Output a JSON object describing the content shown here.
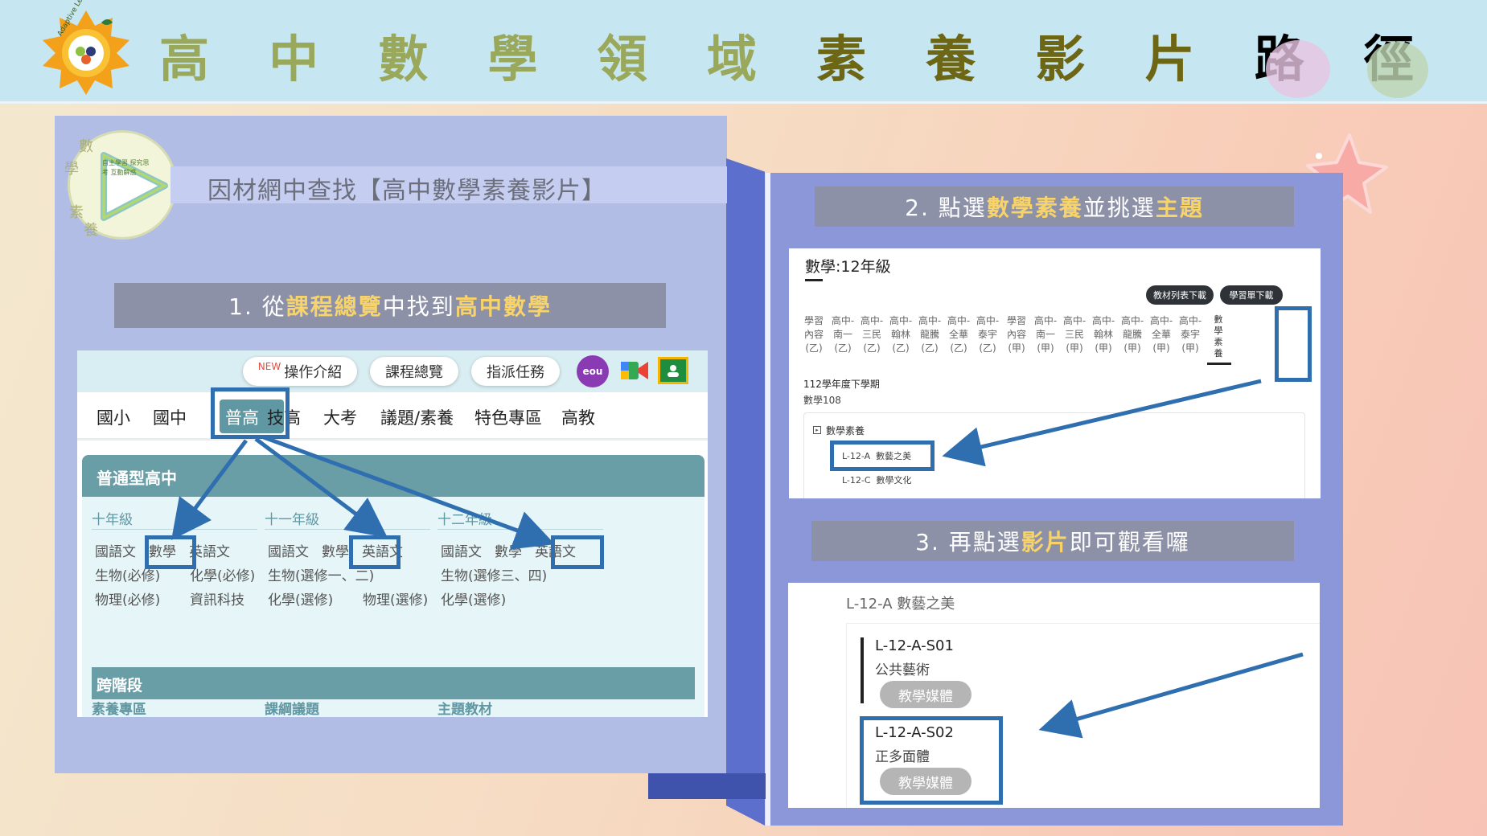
{
  "header": {
    "title_chars": [
      "高",
      "中",
      "數",
      "學",
      "領",
      "域",
      "素",
      "養",
      "影",
      "片",
      "路",
      "徑"
    ],
    "title_colors": [
      "#9aa85b",
      "#9aa85b",
      "#9aa85b",
      "#9aa85b",
      "#9aa85b",
      "#9aa85b",
      "#6d6614",
      "#6d6614",
      "#6d6614",
      "#6d6614",
      "#000000",
      "#000000"
    ],
    "logo_text": "Adaptive Learning"
  },
  "left": {
    "title": "因材網中查找【高中數學素養影片】",
    "emblem_chars": [
      "數",
      "學",
      "素",
      "養"
    ],
    "emblem_inner": "自主學習 探究思考 互動解惑",
    "step1": {
      "prefix": "1. 從",
      "hl1": "課程總覽",
      "middle": "中找到",
      "hl2": "高中數學"
    },
    "shot1": {
      "new_badge": "NEW",
      "buttons": [
        "操作介紹",
        "課程總覽",
        "指派任務"
      ],
      "app_badge": "eou",
      "nav": [
        "國小",
        "國中",
        "普高",
        "技高",
        "大考",
        "議題/素養",
        "特色專區",
        "高教"
      ],
      "section": "普通型高中",
      "grades": [
        {
          "title": "十年級",
          "rows": [
            [
              "國語文",
              "數學",
              "英語文"
            ],
            [
              "生物(必修)",
              "化學(必修)"
            ],
            [
              "物理(必修)",
              "資訊科技"
            ]
          ]
        },
        {
          "title": "十一年級",
          "rows": [
            [
              "國語文",
              "數學",
              "英語文"
            ],
            [
              "生物(選修一、二)"
            ],
            [
              "化學(選修)",
              "物理(選修)"
            ]
          ]
        },
        {
          "title": "十二年級",
          "rows": [
            [
              "國語文",
              "數學",
              "英語文"
            ],
            [
              "生物(選修三、四)"
            ],
            [
              "化學(選修)"
            ]
          ]
        }
      ],
      "cross_section": "跨階段",
      "cross_items": [
        "素養專區",
        "課綱議題",
        "主題教材"
      ]
    }
  },
  "right": {
    "step2": {
      "prefix": "2. 點選",
      "hl1": "數學素養",
      "middle": "並挑選",
      "hl2": "主題"
    },
    "step3": {
      "prefix": "3. 再點選",
      "hl1": "影片",
      "suffix": "即可觀看囉"
    },
    "shot2": {
      "heading": "數學:12年級",
      "pills": [
        "教材列表下載",
        "學習單下載"
      ],
      "tabs": [
        [
          "學習",
          "內容",
          "(乙)"
        ],
        [
          "高中-",
          "南一",
          "(乙)"
        ],
        [
          "高中-",
          "三民",
          "(乙)"
        ],
        [
          "高中-",
          "翰林",
          "(乙)"
        ],
        [
          "高中-",
          "龍騰",
          "(乙)"
        ],
        [
          "高中-",
          "全華",
          "(乙)"
        ],
        [
          "高中-",
          "泰宇",
          "(乙)"
        ],
        [
          "學習",
          "內容",
          "(甲)"
        ],
        [
          "高中-",
          "南一",
          "(甲)"
        ],
        [
          "高中-",
          "三民",
          "(甲)"
        ],
        [
          "高中-",
          "翰林",
          "(甲)"
        ],
        [
          "高中-",
          "龍騰",
          "(甲)"
        ],
        [
          "高中-",
          "全華",
          "(甲)"
        ],
        [
          "高中-",
          "泰宇",
          "(甲)"
        ]
      ],
      "math_tab": [
        "數",
        "學",
        "素",
        "養"
      ],
      "semester": "112學年度下學期",
      "code": "數學108",
      "card_title": "數學素養",
      "items": [
        "L-12-A  數藝之美",
        "L-12-C  數學文化"
      ]
    },
    "shot3": {
      "heading": "L-12-A 數藝之美",
      "lessons": [
        {
          "code": "L-12-A-S01",
          "name": "公共藝術",
          "button": "教學媒體"
        },
        {
          "code": "L-12-A-S02",
          "name": "正多面體",
          "button": "教學媒體"
        }
      ]
    }
  },
  "colors": {
    "accent": "#2f6fb0",
    "teal": "#5f98a3",
    "highlight": "#f7d36a"
  }
}
